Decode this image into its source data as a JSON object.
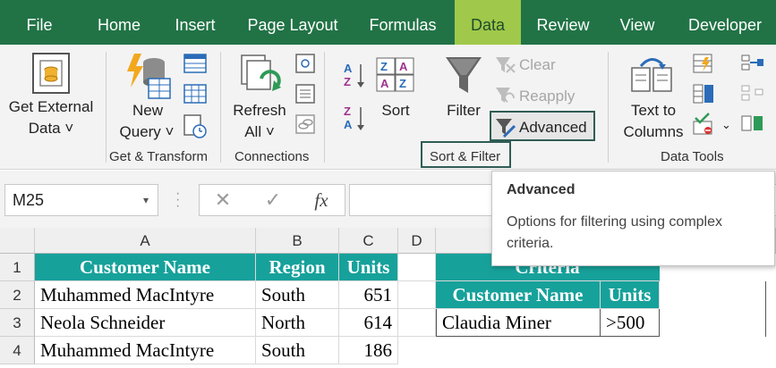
{
  "tabs": [
    {
      "label": "File",
      "active": false
    },
    {
      "label": "Home",
      "active": false
    },
    {
      "label": "Insert",
      "active": false
    },
    {
      "label": "Page Layout",
      "active": false
    },
    {
      "label": "Formulas",
      "active": false
    },
    {
      "label": "Data",
      "active": true
    },
    {
      "label": "Review",
      "active": false
    },
    {
      "label": "View",
      "active": false
    },
    {
      "label": "Developer",
      "active": false
    }
  ],
  "ribbon": {
    "get_external": {
      "line1": "Get External",
      "line2": "Data ˅"
    },
    "new_query": {
      "line1": "New",
      "line2": "Query ˅"
    },
    "refresh_all": {
      "line1": "Refresh",
      "line2": "All ˅"
    },
    "sort": "Sort",
    "filter": "Filter",
    "clear": "Clear",
    "reapply": "Reapply",
    "advanced": "Advanced",
    "text_to_columns": {
      "line1": "Text to",
      "line2": "Columns"
    },
    "groups": {
      "get_transform": "Get & Transform",
      "connections": "Connections",
      "sort_filter": "Sort & Filter",
      "data_tools": "Data Tools"
    }
  },
  "formula_bar": {
    "name_box": "M25",
    "cancel": "✕",
    "enter": "✓",
    "fx": "fx",
    "value": ""
  },
  "grid": {
    "columns": [
      "A",
      "B",
      "C",
      "D"
    ],
    "rows": [
      "1",
      "2",
      "3",
      "4"
    ],
    "table": {
      "headers": [
        "Customer Name",
        "Region",
        "Units"
      ],
      "rows": [
        [
          "Muhammed MacIntyre",
          "South",
          "651"
        ],
        [
          "Neola Schneider",
          "North",
          "614"
        ],
        [
          "Muhammed MacIntyre",
          "South",
          "186"
        ]
      ]
    },
    "criteria": {
      "title": "Criteria",
      "headers": [
        "Customer Name",
        "Units"
      ],
      "row": [
        "Claudia Miner",
        ">500"
      ]
    }
  },
  "tooltip": {
    "title": "Advanced",
    "body": "Options for filtering using complex criteria."
  },
  "colors": {
    "tab_bar": "#217346",
    "active_tab": "#a0c84a",
    "table_header": "#17a19b"
  }
}
